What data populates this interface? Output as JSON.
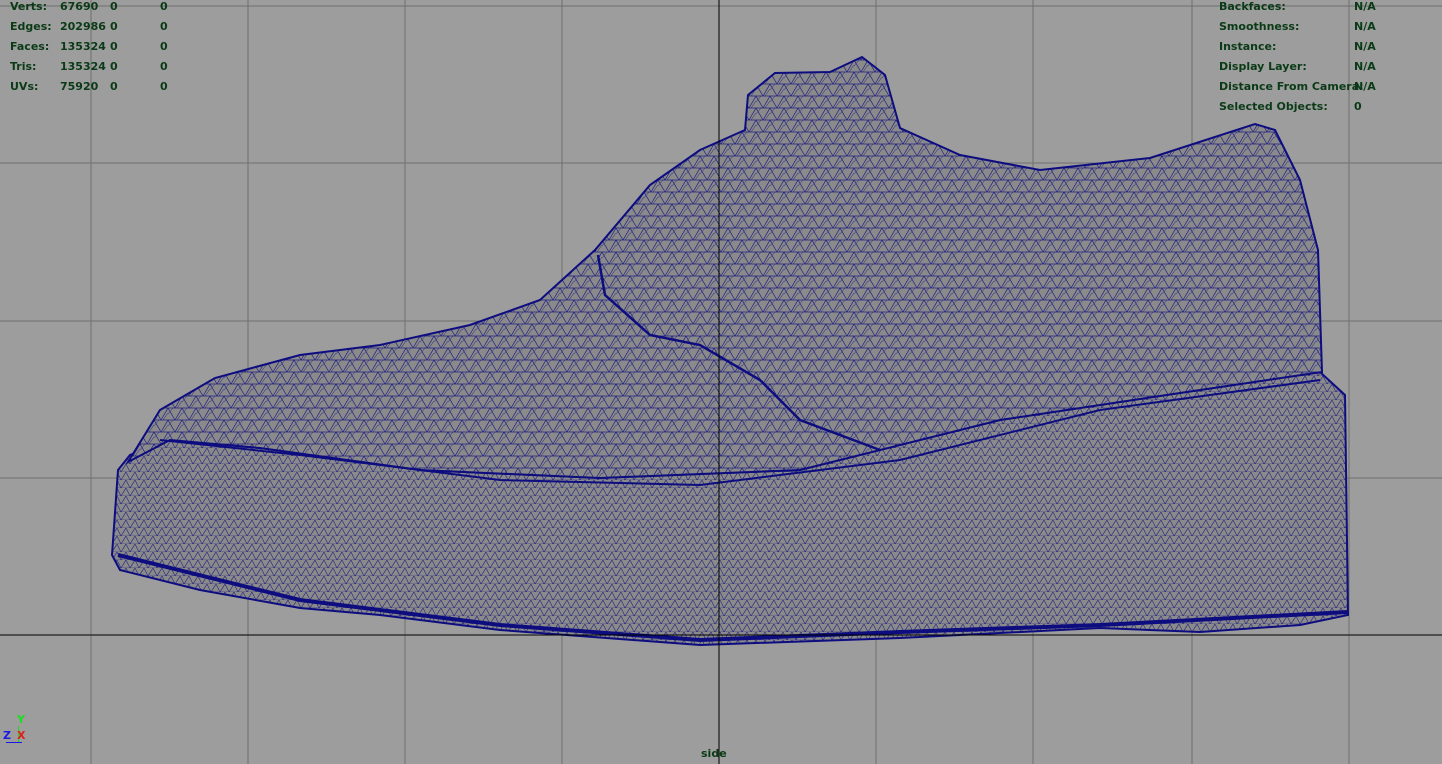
{
  "viewport": {
    "view_name": "side",
    "background_color": "#9d9d9d",
    "grid_color": "#6e6e6e",
    "axis_color": "#000000",
    "wireframe_color": "#0d0d80",
    "shade_color": "#8a8a8a",
    "hud_text_color": "#0a3a16"
  },
  "poly_count": {
    "rows": [
      {
        "label": "Verts:",
        "v1": "67690",
        "v2": "0",
        "v3": "0"
      },
      {
        "label": "Edges:",
        "v1": "202986",
        "v2": "0",
        "v3": "0"
      },
      {
        "label": "Faces:",
        "v1": "135324",
        "v2": "0",
        "v3": "0"
      },
      {
        "label": "Tris:",
        "v1": "135324",
        "v2": "0",
        "v3": "0"
      },
      {
        "label": "UVs:",
        "v1": "75920",
        "v2": "0",
        "v3": "0"
      }
    ]
  },
  "object_details": {
    "rows": [
      {
        "label": "Backfaces:",
        "value": "N/A"
      },
      {
        "label": "Smoothness:",
        "value": "N/A"
      },
      {
        "label": "Instance:",
        "value": "N/A"
      },
      {
        "label": "Display Layer:",
        "value": "N/A"
      },
      {
        "label": "Distance From Camera:",
        "value": "N/A"
      },
      {
        "label": "Selected Objects:",
        "value": "0"
      }
    ]
  },
  "axis_gizmo": {
    "y_label": "Y",
    "z_label": "Z",
    "x_label": "X",
    "y_color": "#18e018",
    "z_color": "#1a1ae6",
    "x_color": "#e01c1c"
  },
  "model": {
    "name_icon": "shoe-wireframe-mesh"
  }
}
